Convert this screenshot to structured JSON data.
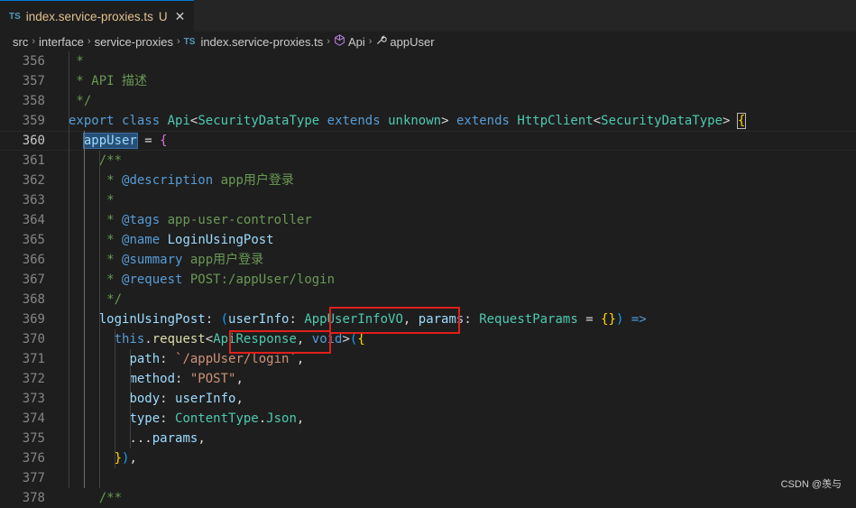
{
  "tab": {
    "lang_badge": "TS",
    "filename": "index.service-proxies.ts",
    "modified_flag": "U",
    "close_glyph": "✕"
  },
  "breadcrumb": {
    "items": [
      "src",
      "interface",
      "service-proxies"
    ],
    "file_badge": "TS",
    "file": "index.service-proxies.ts",
    "class": "Api",
    "member": "appUser",
    "separator": "›"
  },
  "editor": {
    "active_line": 360,
    "lines": [
      {
        "no": "356",
        "tokens": [
          {
            "t": " *",
            "c": "c-com"
          }
        ]
      },
      {
        "no": "357",
        "tokens": [
          {
            "t": " * API 描述",
            "c": "c-com"
          }
        ]
      },
      {
        "no": "358",
        "tokens": [
          {
            "t": " */",
            "c": "c-com"
          }
        ]
      },
      {
        "no": "359",
        "tokens": [
          {
            "t": "export",
            "c": "c-kw"
          },
          {
            "t": " ",
            "c": "c-op"
          },
          {
            "t": "class",
            "c": "c-kw"
          },
          {
            "t": " ",
            "c": "c-op"
          },
          {
            "t": "Api",
            "c": "c-type"
          },
          {
            "t": "<",
            "c": "c-op"
          },
          {
            "t": "SecurityDataType",
            "c": "c-type"
          },
          {
            "t": " ",
            "c": "c-op"
          },
          {
            "t": "extends",
            "c": "c-kw"
          },
          {
            "t": " ",
            "c": "c-op"
          },
          {
            "t": "unknown",
            "c": "c-type"
          },
          {
            "t": "> ",
            "c": "c-op"
          },
          {
            "t": "extends",
            "c": "c-kw"
          },
          {
            "t": " ",
            "c": "c-op"
          },
          {
            "t": "HttpClient",
            "c": "c-type"
          },
          {
            "t": "<",
            "c": "c-op"
          },
          {
            "t": "SecurityDataType",
            "c": "c-type"
          },
          {
            "t": "> ",
            "c": "c-op"
          },
          {
            "t": "{",
            "c": "c-br1 bracket-match"
          }
        ]
      },
      {
        "no": "360",
        "tokens": [
          {
            "t": "  ",
            "c": "c-op"
          },
          {
            "t": "appUser",
            "c": "c-var hl-word"
          },
          {
            "t": " = ",
            "c": "c-op"
          },
          {
            "t": "{",
            "c": "c-br2"
          }
        ]
      },
      {
        "no": "361",
        "tokens": [
          {
            "t": "    /**",
            "c": "c-com"
          }
        ]
      },
      {
        "no": "362",
        "tokens": [
          {
            "t": "     * ",
            "c": "c-com"
          },
          {
            "t": "@description",
            "c": "c-tag"
          },
          {
            "t": " app用户登录",
            "c": "c-com"
          }
        ]
      },
      {
        "no": "363",
        "tokens": [
          {
            "t": "     *",
            "c": "c-com"
          }
        ]
      },
      {
        "no": "364",
        "tokens": [
          {
            "t": "     * ",
            "c": "c-com"
          },
          {
            "t": "@tags",
            "c": "c-tag"
          },
          {
            "t": " app-user-controller",
            "c": "c-com"
          }
        ]
      },
      {
        "no": "365",
        "tokens": [
          {
            "t": "     * ",
            "c": "c-com"
          },
          {
            "t": "@name",
            "c": "c-tag"
          },
          {
            "t": " ",
            "c": "c-com"
          },
          {
            "t": "LoginUsingPost",
            "c": "c-var"
          }
        ]
      },
      {
        "no": "366",
        "tokens": [
          {
            "t": "     * ",
            "c": "c-com"
          },
          {
            "t": "@summary",
            "c": "c-tag"
          },
          {
            "t": " app用户登录",
            "c": "c-com"
          }
        ]
      },
      {
        "no": "367",
        "tokens": [
          {
            "t": "     * ",
            "c": "c-com"
          },
          {
            "t": "@request",
            "c": "c-tag"
          },
          {
            "t": " POST:/appUser/login",
            "c": "c-com"
          }
        ]
      },
      {
        "no": "368",
        "tokens": [
          {
            "t": "     */",
            "c": "c-com"
          }
        ]
      },
      {
        "no": "369",
        "tokens": [
          {
            "t": "    ",
            "c": "c-op"
          },
          {
            "t": "loginUsingPost",
            "c": "c-var"
          },
          {
            "t": ": ",
            "c": "c-op"
          },
          {
            "t": "(",
            "c": "c-br3"
          },
          {
            "t": "userInfo",
            "c": "c-var"
          },
          {
            "t": ": ",
            "c": "c-op"
          },
          {
            "t": "AppUserInfoVO",
            "c": "c-type"
          },
          {
            "t": ", ",
            "c": "c-op"
          },
          {
            "t": "params",
            "c": "c-var"
          },
          {
            "t": ": ",
            "c": "c-op"
          },
          {
            "t": "RequestParams",
            "c": "c-type"
          },
          {
            "t": " = ",
            "c": "c-op"
          },
          {
            "t": "{}",
            "c": "c-br1"
          },
          {
            "t": ")",
            "c": "c-br3"
          },
          {
            "t": " ",
            "c": "c-op"
          },
          {
            "t": "=>",
            "c": "c-kw"
          }
        ]
      },
      {
        "no": "370",
        "tokens": [
          {
            "t": "      ",
            "c": "c-op"
          },
          {
            "t": "this",
            "c": "c-kw"
          },
          {
            "t": ".",
            "c": "c-op"
          },
          {
            "t": "request",
            "c": "c-fn"
          },
          {
            "t": "<",
            "c": "c-op"
          },
          {
            "t": "ApiResponse",
            "c": "c-type"
          },
          {
            "t": ", ",
            "c": "c-op"
          },
          {
            "t": "void",
            "c": "c-kw"
          },
          {
            "t": ">",
            "c": "c-op"
          },
          {
            "t": "(",
            "c": "c-br3"
          },
          {
            "t": "{",
            "c": "c-br1"
          }
        ]
      },
      {
        "no": "371",
        "tokens": [
          {
            "t": "        ",
            "c": "c-op"
          },
          {
            "t": "path",
            "c": "c-var"
          },
          {
            "t": ": ",
            "c": "c-op"
          },
          {
            "t": "`/appUser/login`",
            "c": "c-str"
          },
          {
            "t": ",",
            "c": "c-op"
          }
        ]
      },
      {
        "no": "372",
        "tokens": [
          {
            "t": "        ",
            "c": "c-op"
          },
          {
            "t": "method",
            "c": "c-var"
          },
          {
            "t": ": ",
            "c": "c-op"
          },
          {
            "t": "\"POST\"",
            "c": "c-str"
          },
          {
            "t": ",",
            "c": "c-op"
          }
        ]
      },
      {
        "no": "373",
        "tokens": [
          {
            "t": "        ",
            "c": "c-op"
          },
          {
            "t": "body",
            "c": "c-var"
          },
          {
            "t": ": ",
            "c": "c-op"
          },
          {
            "t": "userInfo",
            "c": "c-var"
          },
          {
            "t": ",",
            "c": "c-op"
          }
        ]
      },
      {
        "no": "374",
        "tokens": [
          {
            "t": "        ",
            "c": "c-op"
          },
          {
            "t": "type",
            "c": "c-var"
          },
          {
            "t": ": ",
            "c": "c-op"
          },
          {
            "t": "ContentType",
            "c": "c-type"
          },
          {
            "t": ".",
            "c": "c-op"
          },
          {
            "t": "Json",
            "c": "c-type"
          },
          {
            "t": ",",
            "c": "c-op"
          }
        ]
      },
      {
        "no": "375",
        "tokens": [
          {
            "t": "        ",
            "c": "c-op"
          },
          {
            "t": "...",
            "c": "c-op"
          },
          {
            "t": "params",
            "c": "c-var"
          },
          {
            "t": ",",
            "c": "c-op"
          }
        ]
      },
      {
        "no": "376",
        "tokens": [
          {
            "t": "      ",
            "c": "c-op"
          },
          {
            "t": "}",
            "c": "c-br1"
          },
          {
            "t": ")",
            "c": "c-br3"
          },
          {
            "t": ",",
            "c": "c-op"
          }
        ]
      },
      {
        "no": "377",
        "tokens": []
      },
      {
        "no": "378",
        "tokens": [
          {
            "t": "    /**",
            "c": "c-com"
          }
        ]
      }
    ]
  },
  "watermark": "CSDN @羡与",
  "colors": {
    "background": "#1e1e1e",
    "annotation_box": "#e0201b"
  }
}
